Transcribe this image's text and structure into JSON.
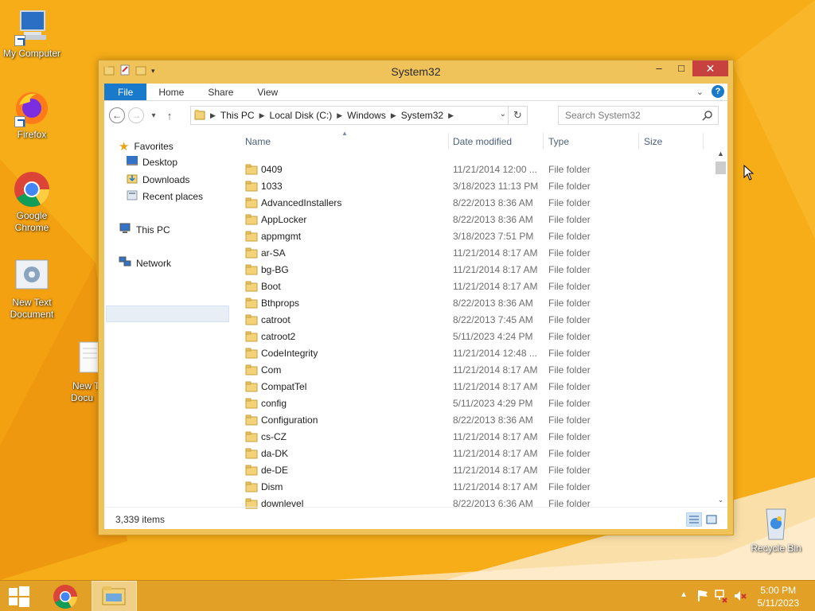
{
  "desktop": {
    "icons": [
      {
        "label": "My Computer",
        "icon": "computer-icon"
      },
      {
        "label": "Firefox",
        "icon": "firefox-icon"
      },
      {
        "label": "Google Chrome",
        "icon": "chrome-icon"
      },
      {
        "label": "New Text Document",
        "icon": "text-document-icon"
      },
      {
        "label": "New Text Document",
        "icon": "blank-document-icon"
      },
      {
        "label": "Recycle Bin",
        "icon": "recycle-bin-icon"
      }
    ],
    "recycle_bin_label": "Recycle Bin",
    "partial_icon_line1": "New T",
    "partial_icon_line2": "Docu"
  },
  "window": {
    "title": "System32",
    "min": "–",
    "max": "□",
    "close": "✕"
  },
  "ribbon": {
    "tabs": [
      "File",
      "Home",
      "Share",
      "View"
    ],
    "help": "?"
  },
  "address": {
    "crumbs": [
      "This PC",
      "Local Disk (C:)",
      "Windows",
      "System32"
    ]
  },
  "search": {
    "placeholder": "Search System32"
  },
  "navpane": {
    "favorites": "Favorites",
    "desktop": "Desktop",
    "downloads": "Downloads",
    "recent": "Recent places",
    "thispc": "This PC",
    "network": "Network"
  },
  "columns": {
    "name": "Name",
    "date": "Date modified",
    "type": "Type",
    "size": "Size"
  },
  "files": [
    {
      "name": "0409",
      "date": "11/21/2014 12:00 ...",
      "type": "File folder"
    },
    {
      "name": "1033",
      "date": "3/18/2023 11:13 PM",
      "type": "File folder"
    },
    {
      "name": "AdvancedInstallers",
      "date": "8/22/2013 8:36 AM",
      "type": "File folder"
    },
    {
      "name": "AppLocker",
      "date": "8/22/2013 8:36 AM",
      "type": "File folder"
    },
    {
      "name": "appmgmt",
      "date": "3/18/2023 7:51 PM",
      "type": "File folder"
    },
    {
      "name": "ar-SA",
      "date": "11/21/2014 8:17 AM",
      "type": "File folder"
    },
    {
      "name": "bg-BG",
      "date": "11/21/2014 8:17 AM",
      "type": "File folder"
    },
    {
      "name": "Boot",
      "date": "11/21/2014 8:17 AM",
      "type": "File folder"
    },
    {
      "name": "Bthprops",
      "date": "8/22/2013 8:36 AM",
      "type": "File folder"
    },
    {
      "name": "catroot",
      "date": "8/22/2013 7:45 AM",
      "type": "File folder"
    },
    {
      "name": "catroot2",
      "date": "5/11/2023 4:24 PM",
      "type": "File folder"
    },
    {
      "name": "CodeIntegrity",
      "date": "11/21/2014 12:48 ...",
      "type": "File folder"
    },
    {
      "name": "Com",
      "date": "11/21/2014 8:17 AM",
      "type": "File folder"
    },
    {
      "name": "CompatTel",
      "date": "11/21/2014 8:17 AM",
      "type": "File folder"
    },
    {
      "name": "config",
      "date": "5/11/2023 4:29 PM",
      "type": "File folder"
    },
    {
      "name": "Configuration",
      "date": "8/22/2013 8:36 AM",
      "type": "File folder"
    },
    {
      "name": "cs-CZ",
      "date": "11/21/2014 8:17 AM",
      "type": "File folder"
    },
    {
      "name": "da-DK",
      "date": "11/21/2014 8:17 AM",
      "type": "File folder"
    },
    {
      "name": "de-DE",
      "date": "11/21/2014 8:17 AM",
      "type": "File folder"
    },
    {
      "name": "Dism",
      "date": "11/21/2014 8:17 AM",
      "type": "File folder"
    },
    {
      "name": "downlevel",
      "date": "8/22/2013 6:36 AM",
      "type": "File folder"
    }
  ],
  "status": {
    "items": "3,339 items"
  },
  "taskbar": {
    "time": "5:00 PM",
    "date": "5/11/2023"
  },
  "colors": {
    "accent": "#1979ca",
    "titlebar": "#efc25a",
    "close": "#c7413e",
    "taskbar": "#e2a026"
  }
}
